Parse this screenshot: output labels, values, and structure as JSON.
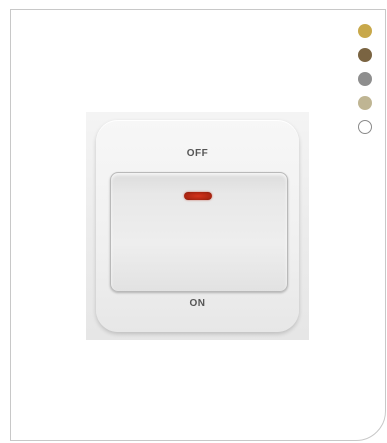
{
  "product": {
    "off_label": "OFF",
    "on_label": "ON"
  },
  "swatches": [
    {
      "name": "gold",
      "color": "#c8a84a"
    },
    {
      "name": "bronze",
      "color": "#7a6442"
    },
    {
      "name": "grey",
      "color": "#8e8e8e"
    },
    {
      "name": "champagne",
      "color": "#bfb593"
    },
    {
      "name": "white",
      "color": "#ffffff"
    }
  ]
}
